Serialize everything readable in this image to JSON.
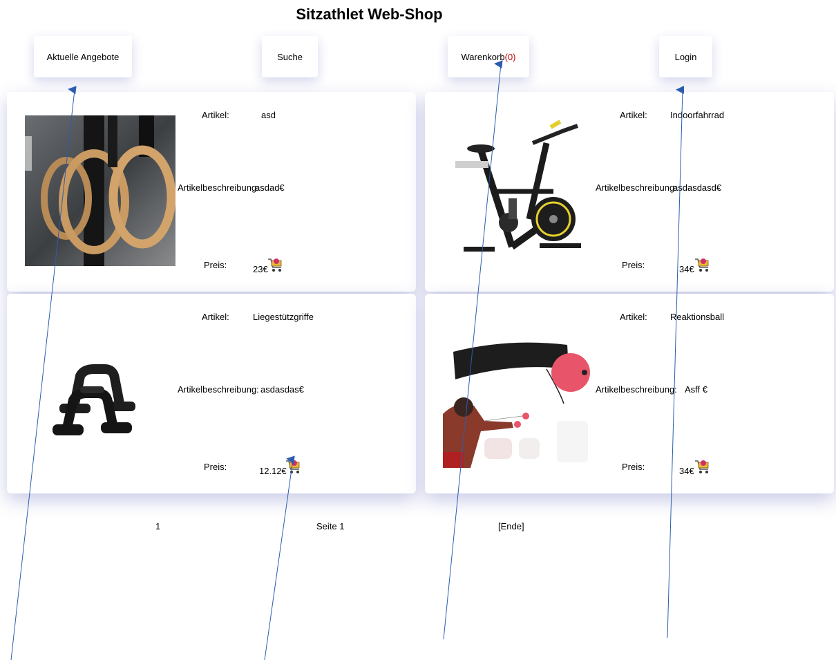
{
  "page": {
    "title": "Sitzathlet Web-Shop"
  },
  "nav": {
    "offers": "Aktuelle Angebote",
    "search": "Suche",
    "cart": "Warenkorb",
    "cart_count": "(0)",
    "login": "Login"
  },
  "labels": {
    "article": "Artikel:",
    "description": "Artikelbeschreibung:",
    "price": "Preis:"
  },
  "products": [
    {
      "name": "asd",
      "description": "asdad€",
      "price": "23€",
      "image": "gymnastic-rings"
    },
    {
      "name": "Indoorfahrrad",
      "description": "asdasdasd€",
      "price": "34€",
      "image": "indoor-bike"
    },
    {
      "name": "Liegestützgriffe",
      "description": "asdasdas€",
      "price": "12.12€",
      "image": "pushup-handles"
    },
    {
      "name": "Reaktionsball",
      "description": "Asff €",
      "price": "34€",
      "image": "reflex-ball"
    }
  ],
  "pagination": {
    "current": "1",
    "page_link": "Seite 1",
    "end_link": "[Ende]"
  },
  "colors": {
    "cart_count": "#c00000",
    "arrow": "#2a5db0",
    "card_shadow": "#3c46aa",
    "visited_link": "#551a8b"
  }
}
